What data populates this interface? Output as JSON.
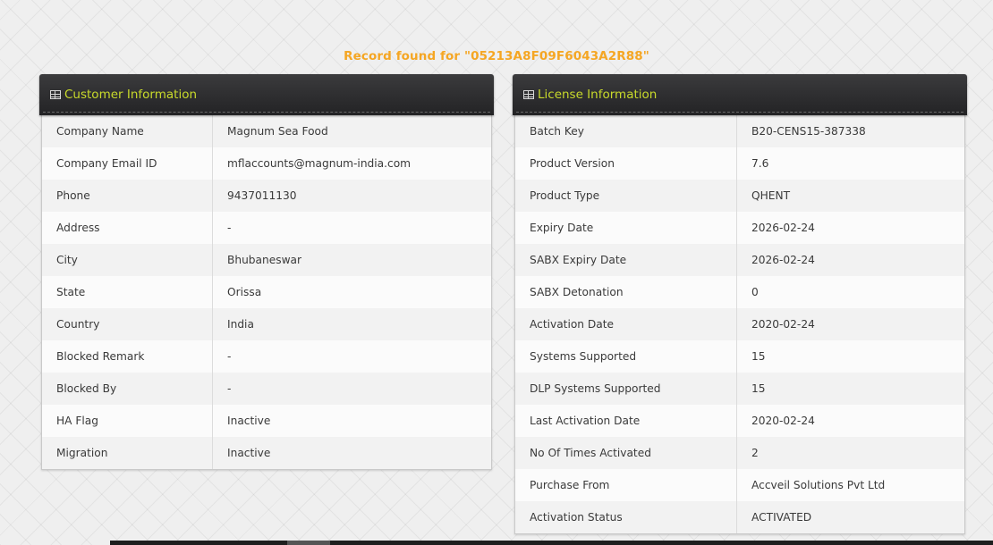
{
  "record_found": {
    "prefix": "Record found for ",
    "key": "\"05213A8F09F6043A2R88\""
  },
  "customer_panel": {
    "title": "Customer Information",
    "icon": "table-icon",
    "rows": [
      {
        "label": "Company Name",
        "value": "Magnum Sea Food"
      },
      {
        "label": "Company Email ID",
        "value": "mflaccounts@magnum-india.com"
      },
      {
        "label": "Phone",
        "value": "9437011130"
      },
      {
        "label": "Address",
        "value": "-"
      },
      {
        "label": "City",
        "value": "Bhubaneswar"
      },
      {
        "label": "State",
        "value": "Orissa"
      },
      {
        "label": "Country",
        "value": "India"
      },
      {
        "label": "Blocked Remark",
        "value": "-"
      },
      {
        "label": "Blocked By",
        "value": "-"
      },
      {
        "label": "HA Flag",
        "value": "Inactive"
      },
      {
        "label": "Migration",
        "value": "Inactive"
      }
    ]
  },
  "license_panel": {
    "title": "License Information",
    "icon": "table-icon",
    "rows": [
      {
        "label": "Batch Key",
        "value": "B20-CENS15-387338"
      },
      {
        "label": "Product Version",
        "value": "7.6"
      },
      {
        "label": "Product Type",
        "value": "QHENT"
      },
      {
        "label": "Expiry Date",
        "value": "2026-02-24"
      },
      {
        "label": "SABX Expiry Date",
        "value": "2026-02-24"
      },
      {
        "label": "SABX Detonation",
        "value": "0"
      },
      {
        "label": "Activation Date",
        "value": "2020-02-24"
      },
      {
        "label": "Systems Supported",
        "value": "15"
      },
      {
        "label": "DLP Systems Supported",
        "value": "15"
      },
      {
        "label": "Last Activation Date",
        "value": "2020-02-24"
      },
      {
        "label": "No Of Times Activated",
        "value": "2"
      },
      {
        "label": "Purchase From",
        "value": "Accveil Solutions Pvt Ltd"
      },
      {
        "label": "Activation Status",
        "value": "ACTIVATED"
      }
    ]
  },
  "colors": {
    "accent_orange": "#f5a623",
    "title_yellow_green": "#c9da2b",
    "header_dark": "#2a2a2c"
  }
}
